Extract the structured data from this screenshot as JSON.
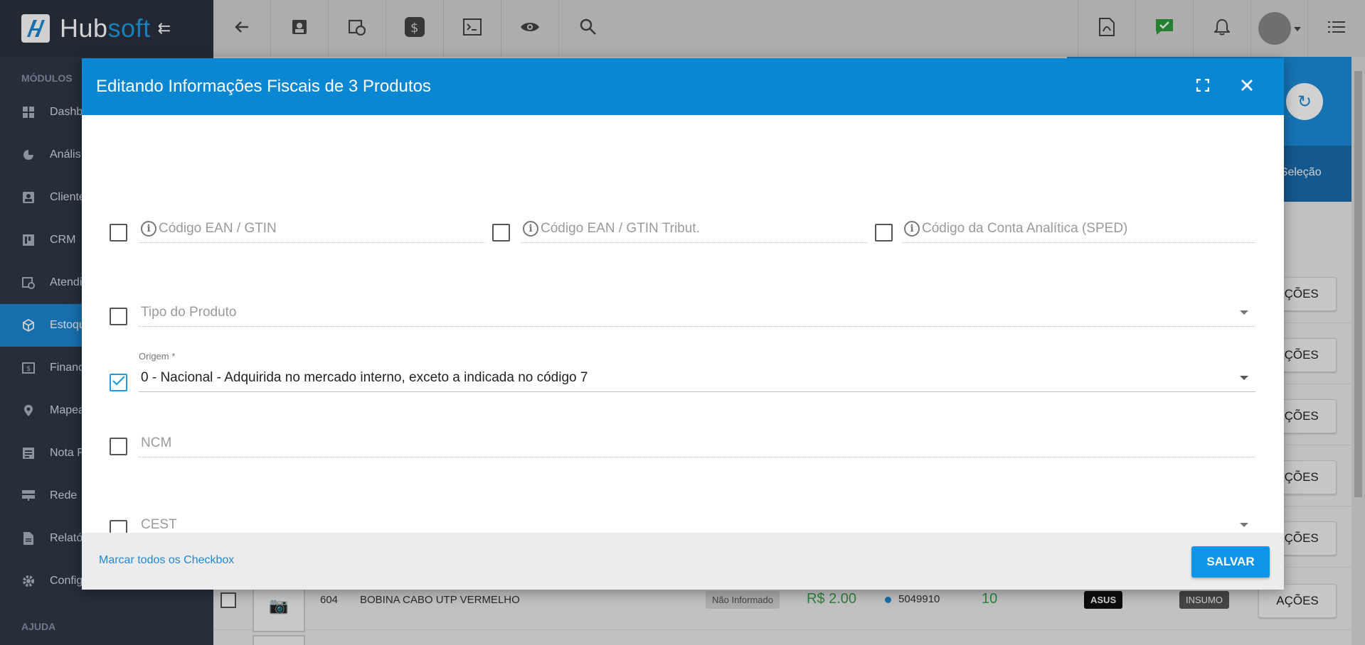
{
  "app": {
    "brand_a": "Hub",
    "brand_b": "soft",
    "collapse_glyph": "⇇"
  },
  "sidebar": {
    "section_modules": "MÓDULOS",
    "section_help": "AJUDA",
    "items": [
      {
        "label": "Dashb",
        "icon": "dashboard-icon"
      },
      {
        "label": "Anális",
        "icon": "pie-chart-icon"
      },
      {
        "label": "Cliente",
        "icon": "contacts-icon"
      },
      {
        "label": "CRM",
        "icon": "crm-board-icon"
      },
      {
        "label": "Atendi",
        "icon": "calendar-clock-icon"
      },
      {
        "label": "Estoqu",
        "icon": "box-icon"
      },
      {
        "label": "Financ",
        "icon": "money-icon"
      },
      {
        "label": "Mapea",
        "icon": "map-pin-icon"
      },
      {
        "label": "Nota F",
        "icon": "invoice-icon"
      },
      {
        "label": "Rede",
        "icon": "network-icon"
      },
      {
        "label": "Relató",
        "icon": "report-icon"
      },
      {
        "label": "Config",
        "icon": "gear-icon"
      }
    ],
    "active_index": 5
  },
  "topbar": {
    "left_buttons": [
      "back-icon",
      "contact-card-icon",
      "calendar-clock-icon",
      "dollar-icon",
      "terminal-icon",
      "eye-icon",
      "search-icon"
    ],
    "right_buttons": [
      "pdf-icon",
      "chat-check-icon",
      "bell-icon",
      "user-avatar",
      "menu-icon"
    ]
  },
  "background": {
    "selection_text": "r Seleção",
    "actions_label": "AÇÕES",
    "actions_partial": "AÇÕES",
    "row": {
      "id": "604",
      "name": "BOBINA CABO UTP VERMELHO",
      "status": "Não Informado",
      "price": "R$ 2.00",
      "code": "5049910",
      "qty": "10",
      "brand": "ASUS",
      "type": "INSUMO"
    }
  },
  "modal": {
    "title": "Editando Informações Fiscais de 3 Produtos",
    "fields": {
      "ean": {
        "label": "Código EAN / GTIN",
        "checked": false
      },
      "ean_trib": {
        "label": "Código EAN / GTIN Tribut.",
        "checked": false
      },
      "conta": {
        "label": "Código da Conta Analítica (SPED)",
        "checked": false
      },
      "tipo": {
        "label": "Tipo do Produto",
        "checked": false
      },
      "origem": {
        "label": "Origem *",
        "value": "0 - Nacional - Adquirida no mercado interno, exceto a indicada no código 7",
        "checked": true
      },
      "ncm": {
        "label": "NCM",
        "checked": false
      },
      "cest": {
        "label": "CEST",
        "checked": false
      }
    },
    "footer": {
      "select_all": "Marcar todos os Checkbox",
      "save": "SALVAR"
    }
  },
  "colors": {
    "primary": "#0a87d2",
    "sidebar": "#2f3848",
    "green": "#38a14a"
  }
}
